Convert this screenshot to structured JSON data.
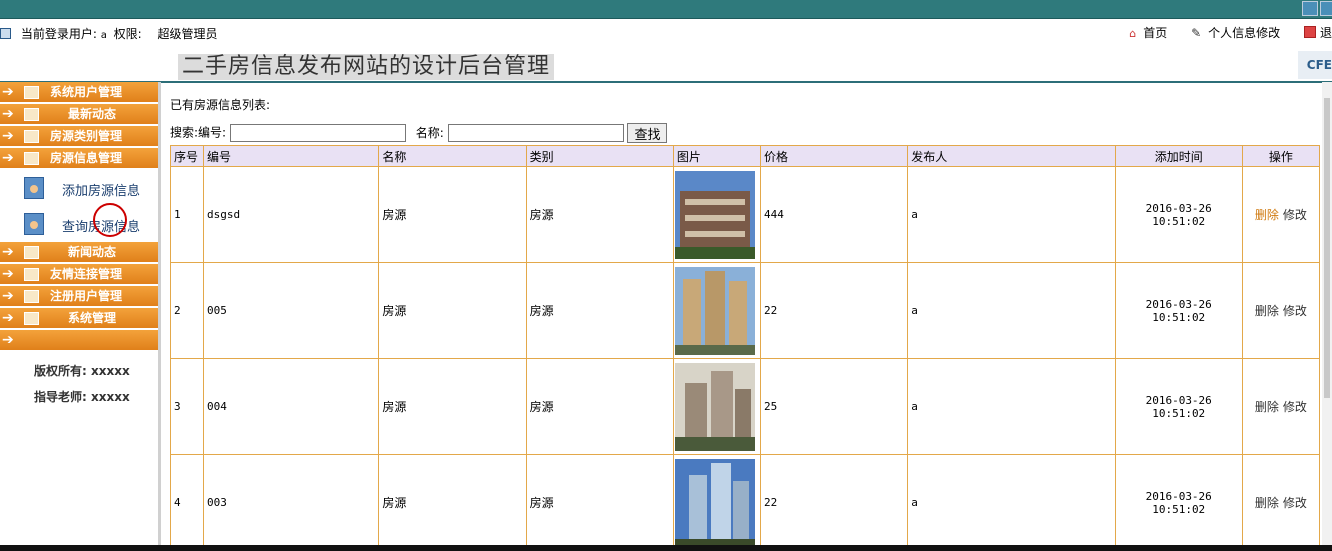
{
  "userbar": {
    "login_label": "当前登录用户:",
    "username": "a",
    "role_label": "权限:",
    "role": "超级管理员",
    "nav": [
      {
        "label": "首页",
        "icon": "home-icon"
      },
      {
        "label": "个人信息修改",
        "icon": "edit-icon"
      },
      {
        "label": "退",
        "icon": "exit-icon"
      }
    ]
  },
  "header": {
    "title": "二手房信息发布网站的设计后台管理",
    "logo": "CFE"
  },
  "sidebar": {
    "menu": [
      {
        "label": "系统用户管理"
      },
      {
        "label": "最新动态"
      },
      {
        "label": "房源类别管理"
      },
      {
        "label": "房源信息管理"
      }
    ],
    "submenu": [
      {
        "label": "添加房源信息"
      },
      {
        "label": "查询房源信息"
      }
    ],
    "menu2": [
      {
        "label": "新闻动态"
      },
      {
        "label": "友情连接管理"
      },
      {
        "label": "注册用户管理"
      },
      {
        "label": "系统管理"
      }
    ],
    "copyright": "版权所有: xxxxx",
    "advisor": "指导老师: xxxxx"
  },
  "main": {
    "list_title": "已有房源信息列表:",
    "search_label": "搜索:编号:",
    "name_label": "名称:",
    "search_value": "",
    "name_value": "",
    "search_button": "查找",
    "columns": [
      "序号",
      "编号",
      "名称",
      "类别",
      "图片",
      "价格",
      "发布人",
      "添加时间",
      "操作"
    ],
    "rows": [
      {
        "idx": "1",
        "code": "dsgsd",
        "name": "房源",
        "category": "房源",
        "price": "444",
        "publisher": "a",
        "time": "2016-03-26 10:51:02",
        "del": "删除",
        "edit": "修改",
        "img_color": "#6a4a3a"
      },
      {
        "idx": "2",
        "code": "005",
        "name": "房源",
        "category": "房源",
        "price": "22",
        "publisher": "a",
        "time": "2016-03-26 10:51:02",
        "del": "删除",
        "edit": "修改",
        "img_color": "#b89a6a"
      },
      {
        "idx": "3",
        "code": "004",
        "name": "房源",
        "category": "房源",
        "price": "25",
        "publisher": "a",
        "time": "2016-03-26 10:51:02",
        "del": "删除",
        "edit": "修改",
        "img_color": "#8a8a80"
      },
      {
        "idx": "4",
        "code": "003",
        "name": "房源",
        "category": "房源",
        "price": "22",
        "publisher": "a",
        "time": "2016-03-26 10:51:02",
        "del": "删除",
        "edit": "修改",
        "img_color": "#7aa0c8"
      }
    ]
  }
}
